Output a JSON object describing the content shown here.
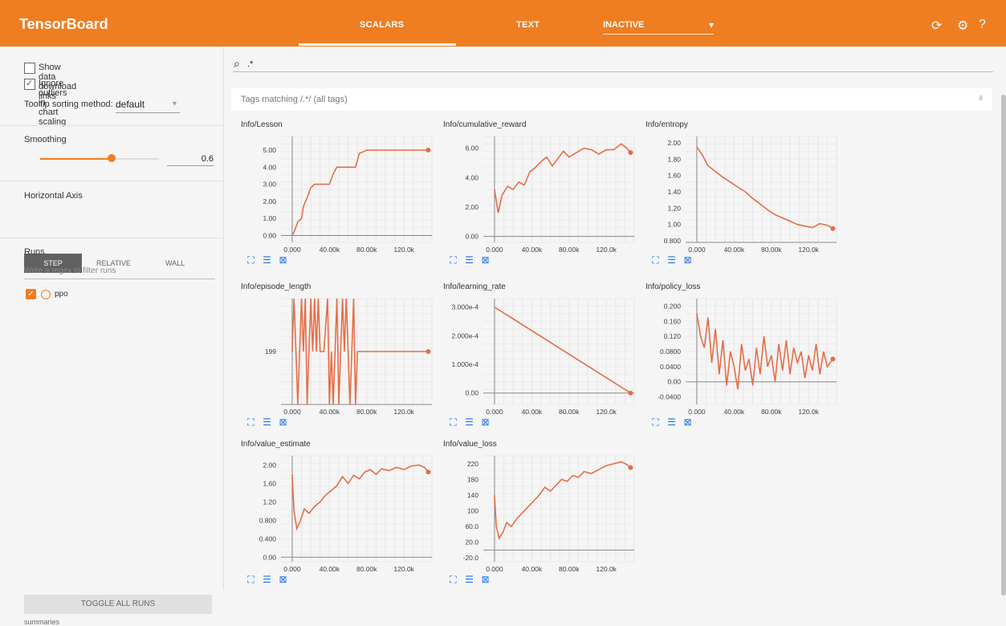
{
  "app": {
    "title": "TensorBoard",
    "accent": "#ef7d21"
  },
  "tabs": [
    {
      "label": "SCALARS"
    },
    {
      "label": "TEXT"
    }
  ],
  "inactive_dropdown": {
    "label": "INACTIVE",
    "icon": "caret-down-icon"
  },
  "toolbar_icons": {
    "refresh": "refresh-icon",
    "settings": "gear-icon",
    "help": "help-icon"
  },
  "sidebar": {
    "show_download_links": "Show data download links",
    "ignore_outliers": "Ignore outliers in chart scaling",
    "tooltip_sort_label": "Tooltip sorting method:",
    "tooltip_sort_value": "default",
    "smoothing_label": "Smoothing",
    "smoothing_value": "0.6",
    "smoothing_level": 0.6,
    "horizontal_axis_label": "Horizontal Axis",
    "axis_buttons": [
      "STEP",
      "RELATIVE",
      "WALL"
    ],
    "runs_label": "Runs",
    "runs_filter_placeholder": "Write a regex to filter runs",
    "run_name": "ppo",
    "toggle_all_runs": "TOGGLE ALL RUNS",
    "summaries": "summaries"
  },
  "search": {
    "value": ".*"
  },
  "tags_bar": {
    "left": "Tags matching /.*/ (all tags)",
    "count": "8"
  },
  "chart_data": [
    {
      "type": "line",
      "title": "Info/Lesson",
      "xlim": [
        -12000,
        150000
      ],
      "ylim": [
        -0.4,
        5.8
      ],
      "xticks": [
        "0.000",
        "40.00k",
        "80.00k",
        "120.0k"
      ],
      "yticks": [
        "0.00",
        "1.00",
        "2.00",
        "3.00",
        "4.00",
        "5.00"
      ],
      "series": [
        {
          "x": [
            0,
            2000,
            4000,
            6000,
            10000,
            12000,
            16000,
            20000,
            24000,
            28000,
            40000,
            44000,
            48000,
            54000,
            68000,
            72000,
            80000,
            100000,
            120000,
            140000,
            146000
          ],
          "y": [
            0.0,
            0.2,
            0.5,
            0.8,
            1.0,
            1.7,
            2.2,
            2.8,
            3.0,
            3.0,
            3.0,
            3.6,
            4.0,
            4.0,
            4.0,
            4.8,
            5.0,
            5.0,
            5.0,
            5.0,
            5.0
          ]
        }
      ]
    },
    {
      "type": "line",
      "title": "Info/cumulative_reward",
      "xlim": [
        -12000,
        150000
      ],
      "ylim": [
        -0.4,
        6.8
      ],
      "xticks": [
        "0.000",
        "40.00k",
        "80.00k",
        "120.0k"
      ],
      "yticks": [
        "0.00",
        "2.00",
        "4.00",
        "6.00"
      ],
      "series": [
        {
          "x": [
            0,
            4000,
            8000,
            14000,
            20000,
            26000,
            32000,
            38000,
            44000,
            50000,
            56000,
            62000,
            68000,
            74000,
            80000,
            88000,
            96000,
            104000,
            112000,
            120000,
            128000,
            136000,
            142000,
            146000
          ],
          "y": [
            3.2,
            1.6,
            2.8,
            3.4,
            3.2,
            3.7,
            3.5,
            4.4,
            4.7,
            5.1,
            5.4,
            4.8,
            5.3,
            5.8,
            5.4,
            5.7,
            6.0,
            5.9,
            5.6,
            5.9,
            5.9,
            6.3,
            6.0,
            5.7
          ]
        }
      ]
    },
    {
      "type": "line",
      "title": "Info/entropy",
      "xlim": [
        -12000,
        150000
      ],
      "ylim": [
        0.78,
        2.08
      ],
      "xticks": [
        "0.000",
        "40.00k",
        "80.00k",
        "120.0k"
      ],
      "yticks": [
        "0.800",
        "1.00",
        "1.20",
        "1.40",
        "1.60",
        "1.80",
        "2.00"
      ],
      "series": [
        {
          "x": [
            0,
            6000,
            12000,
            20000,
            28000,
            36000,
            44000,
            52000,
            60000,
            68000,
            76000,
            84000,
            92000,
            100000,
            108000,
            116000,
            124000,
            132000,
            140000,
            146000
          ],
          "y": [
            1.95,
            1.85,
            1.72,
            1.65,
            1.58,
            1.52,
            1.46,
            1.4,
            1.32,
            1.25,
            1.18,
            1.12,
            1.08,
            1.04,
            1.0,
            0.98,
            0.96,
            1.01,
            0.99,
            0.95
          ]
        }
      ]
    },
    {
      "type": "line",
      "title": "Info/episode_length",
      "xlim": [
        -12000,
        150000
      ],
      "ylim": [
        0,
        2
      ],
      "xticks": [
        "0.000",
        "40.00k",
        "80.00k",
        "120.0k"
      ],
      "yticks": [
        "199"
      ],
      "series": [
        {
          "x": [
            0,
            2000,
            4000,
            6000,
            8000,
            10000,
            12000,
            14000,
            16000,
            18000,
            20000,
            22000,
            24000,
            26000,
            28000,
            30000,
            34000,
            38000,
            40000,
            42000,
            44000,
            46000,
            48000,
            50000,
            52000,
            54000,
            56000,
            58000,
            60000,
            62000,
            64000,
            66000,
            68000,
            70000,
            72000,
            80000,
            100000,
            120000,
            146000
          ],
          "y": [
            1,
            2,
            1,
            0,
            1,
            2,
            1,
            2,
            0,
            1,
            2,
            1,
            2,
            1,
            2,
            1,
            1,
            2,
            0,
            1,
            0,
            1,
            2,
            0,
            1,
            2,
            1,
            2,
            1,
            0,
            1,
            2,
            0,
            1,
            1,
            1,
            1,
            1,
            1
          ]
        }
      ]
    },
    {
      "type": "line",
      "title": "Info/learning_rate",
      "xlim": [
        -12000,
        150000
      ],
      "ylim": [
        -4e-05,
        0.00033
      ],
      "xticks": [
        "0.000",
        "40.00k",
        "80.00k",
        "120.0k"
      ],
      "yticks": [
        "0.00",
        "1.000e-4",
        "2.000e-4",
        "3.000e-4"
      ],
      "series": [
        {
          "x": [
            0,
            146000
          ],
          "y": [
            0.0003,
            0.0
          ]
        }
      ]
    },
    {
      "type": "line",
      "title": "Info/policy_loss",
      "xlim": [
        -12000,
        150000
      ],
      "ylim": [
        -0.06,
        0.22
      ],
      "xticks": [
        "0.000",
        "40.00k",
        "80.00k",
        "120.0k"
      ],
      "yticks": [
        "-0.0400",
        "0.00",
        "0.0400",
        "0.0800",
        "0.120",
        "0.160",
        "0.200"
      ],
      "series": [
        {
          "x": [
            0,
            4000,
            8000,
            12000,
            16000,
            20000,
            24000,
            28000,
            32000,
            36000,
            40000,
            44000,
            48000,
            52000,
            56000,
            60000,
            64000,
            68000,
            72000,
            76000,
            80000,
            84000,
            88000,
            92000,
            96000,
            100000,
            104000,
            108000,
            112000,
            116000,
            120000,
            124000,
            128000,
            132000,
            136000,
            140000,
            146000
          ],
          "y": [
            0.18,
            0.12,
            0.09,
            0.17,
            0.05,
            0.14,
            0.02,
            0.11,
            -0.01,
            0.08,
            0.04,
            -0.02,
            0.1,
            0.03,
            0.06,
            -0.01,
            0.09,
            0.02,
            0.12,
            0.04,
            0.07,
            0.0,
            0.1,
            0.03,
            0.11,
            0.02,
            0.09,
            0.05,
            0.08,
            0.01,
            0.07,
            0.03,
            0.1,
            0.02,
            0.08,
            0.04,
            0.06
          ]
        }
      ]
    },
    {
      "type": "line",
      "title": "Info/value_estimate",
      "xlim": [
        -12000,
        150000
      ],
      "ylim": [
        -0.1,
        2.2
      ],
      "xticks": [
        "0.000",
        "40.00k",
        "80.00k",
        "120.0k"
      ],
      "yticks": [
        "0.00",
        "0.400",
        "0.800",
        "1.20",
        "1.60",
        "2.00"
      ],
      "series": [
        {
          "x": [
            0,
            2000,
            5000,
            9000,
            13000,
            18000,
            24000,
            30000,
            36000,
            42000,
            48000,
            54000,
            60000,
            66000,
            72000,
            78000,
            84000,
            90000,
            96000,
            104000,
            112000,
            120000,
            128000,
            136000,
            142000,
            146000
          ],
          "y": [
            1.8,
            1.0,
            0.62,
            0.8,
            1.05,
            0.95,
            1.1,
            1.2,
            1.35,
            1.45,
            1.55,
            1.75,
            1.6,
            1.78,
            1.7,
            1.85,
            1.9,
            1.8,
            1.92,
            1.88,
            1.95,
            1.9,
            1.98,
            2.0,
            1.95,
            1.85
          ]
        }
      ]
    },
    {
      "type": "line",
      "title": "Info/value_loss",
      "xlim": [
        -12000,
        150000
      ],
      "ylim": [
        -30,
        240
      ],
      "xticks": [
        "0.000",
        "40.00k",
        "80.00k",
        "120.0k"
      ],
      "yticks": [
        "-20.0",
        "20.0",
        "60.0",
        "100",
        "140",
        "180",
        "220"
      ],
      "series": [
        {
          "x": [
            0,
            2000,
            5000,
            9000,
            13000,
            18000,
            24000,
            30000,
            36000,
            42000,
            48000,
            54000,
            60000,
            66000,
            72000,
            78000,
            84000,
            90000,
            96000,
            104000,
            112000,
            120000,
            128000,
            136000,
            142000,
            146000
          ],
          "y": [
            140,
            60,
            30,
            45,
            70,
            60,
            80,
            95,
            110,
            125,
            140,
            160,
            150,
            165,
            180,
            175,
            190,
            185,
            200,
            195,
            205,
            215,
            220,
            225,
            218,
            210
          ]
        }
      ]
    }
  ]
}
